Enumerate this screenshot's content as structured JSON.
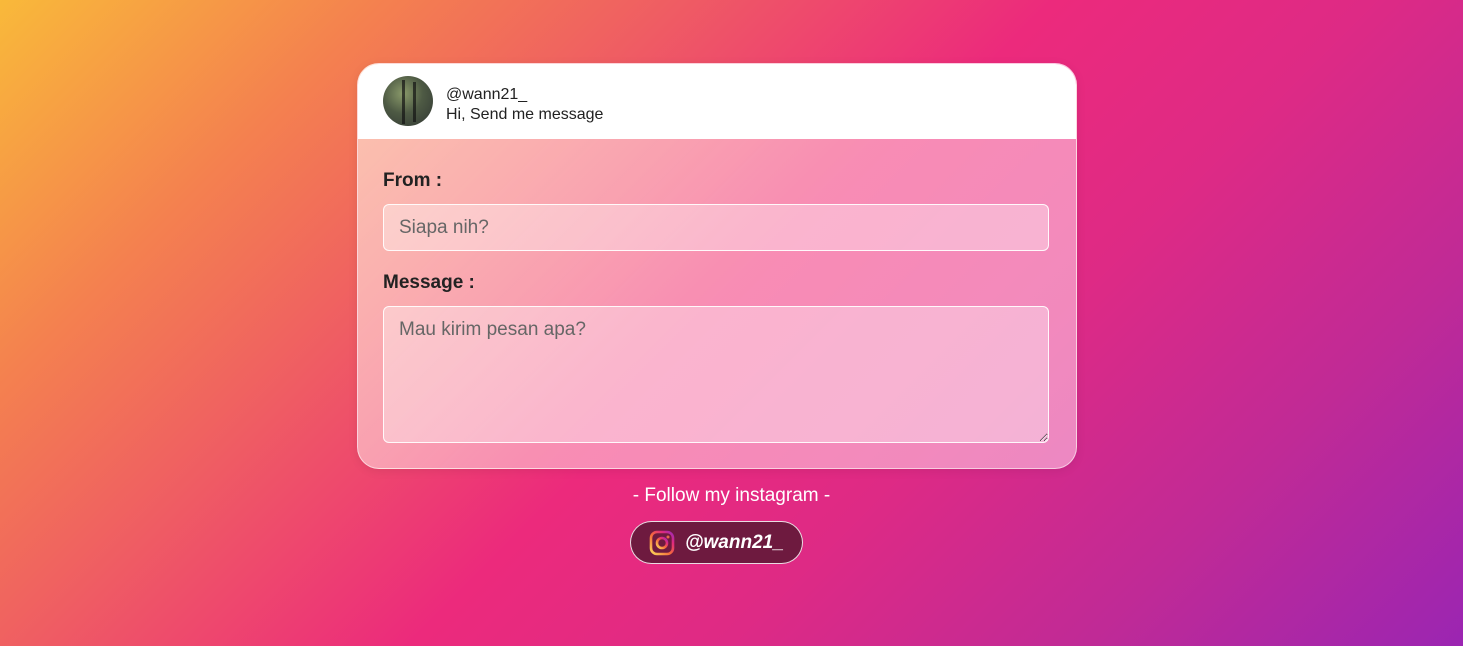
{
  "profile": {
    "username": "@wann21_",
    "tagline": "Hi, Send me message"
  },
  "form": {
    "from_label": "From :",
    "from_placeholder": "Siapa nih?",
    "from_value": "",
    "message_label": "Message :",
    "message_placeholder": "Mau kirim pesan apa?",
    "message_value": ""
  },
  "footer": {
    "follow_text": "- Follow my instagram -",
    "instagram_handle": "@wann21_",
    "instagram_icon": "instagram-icon"
  },
  "colors": {
    "button_bg": "#6e1a3f",
    "gradient_start": "#f9b93a",
    "gradient_mid": "#ec2a7c",
    "gradient_end": "#9b25b2"
  }
}
